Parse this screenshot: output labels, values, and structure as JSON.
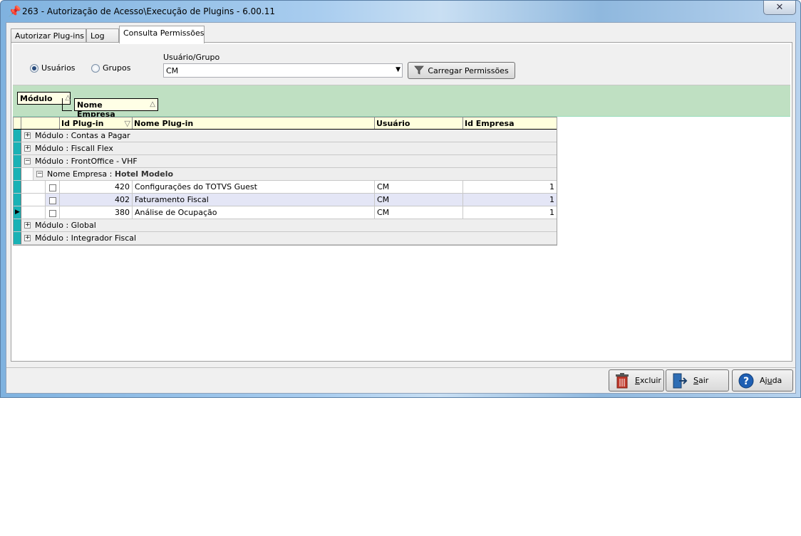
{
  "window": {
    "title": "263 - Autorização de Acesso\\Execução de Plugins - 6.00.11",
    "close_label": "✕"
  },
  "tabs": [
    {
      "label": "Autorizar Plug-ins"
    },
    {
      "label": "Log"
    },
    {
      "label": "Consulta Permissões"
    }
  ],
  "filters": {
    "radio_users": "Usuários",
    "radio_groups": "Grupos",
    "selected": "Usuários",
    "usergroup_label": "Usuário/Grupo",
    "usergroup_value": "CM",
    "load_button": "Carregar Permissões"
  },
  "group_panel": {
    "chip1": "Módulo",
    "chip2": "Nome Empresa"
  },
  "grid": {
    "headers": [
      "Id Plug-in",
      "Nome Plug-in",
      "Usuário",
      "Id Empresa"
    ],
    "groups": [
      {
        "text": "Módulo : Contas a Pagar",
        "expanded": false
      },
      {
        "text": "Módulo : Fiscall Flex",
        "expanded": false
      },
      {
        "text": "Módulo : FrontOffice - VHF",
        "expanded": true
      }
    ],
    "subgroup": {
      "label": "Nome Empresa :",
      "value": "Hotel Modelo"
    },
    "rows": [
      {
        "id": "420",
        "name": "Configurações do TOTVS Guest",
        "user": "CM",
        "company": "1"
      },
      {
        "id": "402",
        "name": "Faturamento Fiscal",
        "user": "CM",
        "company": "1"
      },
      {
        "id": "380",
        "name": "Análise de Ocupação",
        "user": "CM",
        "company": "1"
      }
    ],
    "groups_after": [
      {
        "text": "Módulo : Global",
        "expanded": false
      },
      {
        "text": "Módulo : Integrador Fiscal",
        "expanded": false
      }
    ]
  },
  "buttons": {
    "delete_prefix": "E",
    "delete_rest": "xcluir",
    "exit_prefix": "S",
    "exit_rest": "air",
    "help_prefix": "Aj",
    "help_u": "u",
    "help_rest": "da"
  },
  "colors": {
    "indicator": "#1ab2b5",
    "group_panel": "#bfe0c2",
    "header": "#ffffdd"
  }
}
